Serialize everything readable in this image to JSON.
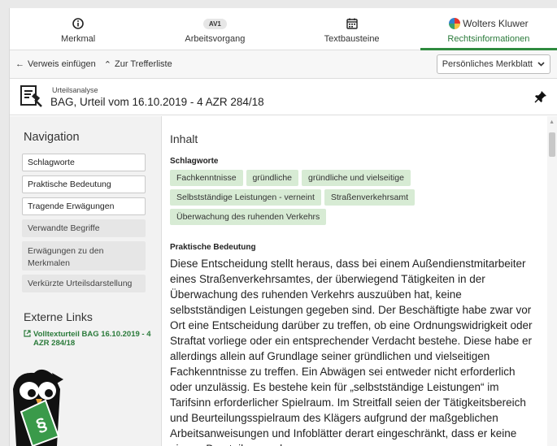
{
  "tabs": [
    {
      "label": "Merkmal"
    },
    {
      "label": "Arbeitsvorgang",
      "badge": "AV1"
    },
    {
      "label": "Textbausteine"
    },
    {
      "brand": "Wolters Kluwer",
      "label": "Rechtsinformationen"
    }
  ],
  "toolbar": {
    "insert_ref": "Verweis einfügen",
    "back": "Zur Trefferliste",
    "dropdown": "Persönliches Merkblatt"
  },
  "titlebar": {
    "subtitle": "Urteilsanalyse",
    "title": "BAG, Urteil vom 16.10.2019 - 4 AZR 284/18"
  },
  "nav": {
    "heading": "Navigation",
    "items": [
      "Schlagworte",
      "Praktische Bedeutung",
      "Tragende Erwägungen",
      "Verwandte Begriffe",
      "Erwägungen zu den Merkmalen",
      "Verkürzte Urteilsdarstellung"
    ],
    "external_heading": "Externe Links",
    "external_link": "Volltexturteil BAG 16.10.2019 - 4 AZR 284/18"
  },
  "content": {
    "heading": "Inhalt",
    "keywords_title": "Schlagworte",
    "keywords": [
      "Fachkenntnisse",
      "gründliche",
      "gründliche und vielseitige",
      "Selbstständige Leistungen - verneint",
      "Straßenverkehrsamt",
      "Überwachung des ruhenden Verkehrs"
    ],
    "practical_title": "Praktische Bedeutung",
    "practical_text": "Diese Entscheidung stellt heraus, dass bei einem Außendienstmitarbeiter eines Straßenverkehrsamtes, der überwiegend Tätigkeiten in der Überwachung des ruhenden Verkehrs auszuüben hat, keine selbstständigen Leistungen gegeben sind. Der Beschäftigte habe zwar vor Ort eine Entscheidung darüber zu treffen, ob eine Ordnungswidrigkeit oder Straftat vorliege oder ein entsprechender Verdacht bestehe. Diese habe er allerdings allein auf Grundlage seiner gründlichen und vielseitigen Fachkenntnisse zu treffen. Ein Abwägen sei entweder nicht erforderlich oder unzulässig. Es bestehe kein für „selbstständige Leistungen“ im Tarifsinn erforderlicher Spielraum. Im Streitfall seien der Tätigkeitsbereich und Beurteilungsspielraum des Klägers aufgrund der maßgeblichen Arbeitsanweisungen und Infoblätter derart eingeschränkt, dass er keine eigene Beurteilung mehr"
  },
  "colors": {
    "accent": "#2f8a3f",
    "tag_bg": "#d7ebd4",
    "nav_bg": "#f2f2f2"
  }
}
